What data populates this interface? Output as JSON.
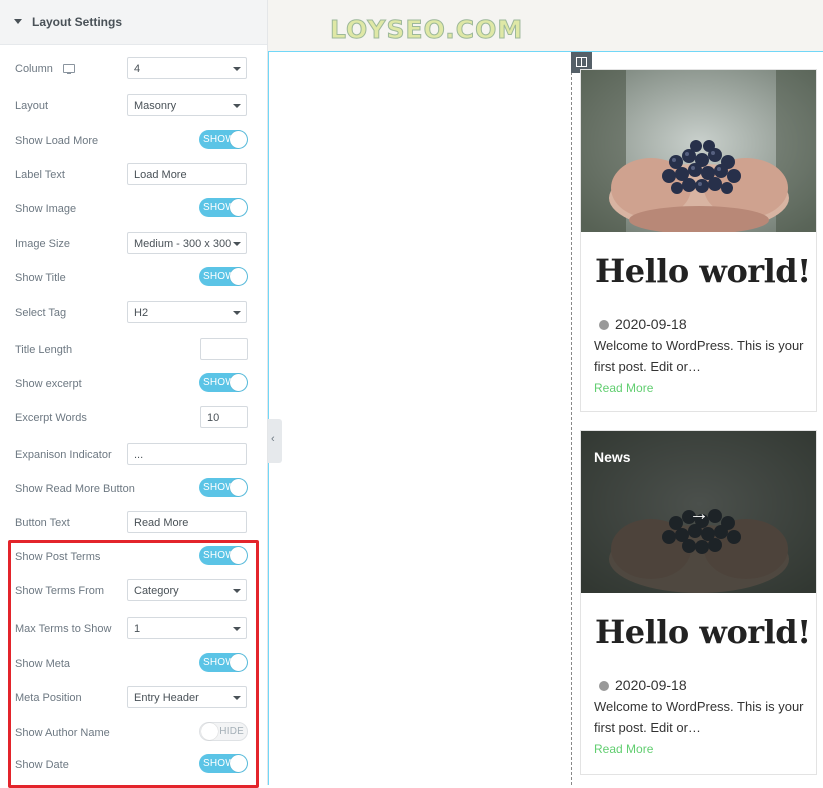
{
  "panel": {
    "section_title": "Layout Settings",
    "controls": [
      {
        "label": "Column",
        "type": "select",
        "value": "4",
        "icon": "monitor-icon"
      },
      {
        "label": "Layout",
        "type": "select",
        "value": "Masonry"
      },
      {
        "label": "Show Load More",
        "type": "toggle",
        "value": "SHOW"
      },
      {
        "label": "Label Text",
        "type": "text",
        "value": "Load More"
      },
      {
        "label": "Show Image",
        "type": "toggle",
        "value": "SHOW"
      },
      {
        "label": "Image Size",
        "type": "select",
        "value": "Medium - 300 x 300"
      },
      {
        "label": "Show Title",
        "type": "toggle",
        "value": "SHOW"
      },
      {
        "label": "Select Tag",
        "type": "select",
        "value": "H2"
      },
      {
        "label": "Title Length",
        "type": "number",
        "value": ""
      },
      {
        "label": "Show excerpt",
        "type": "toggle",
        "value": "SHOW"
      },
      {
        "label": "Excerpt Words",
        "type": "number",
        "value": "10"
      },
      {
        "label": "Expanison Indicator",
        "type": "text",
        "value": "..."
      },
      {
        "label": "Show Read More Button",
        "type": "toggle",
        "value": "SHOW"
      },
      {
        "label": "Button Text",
        "type": "text",
        "value": "Read More"
      },
      {
        "label": "Show Post Terms",
        "type": "toggle",
        "value": "SHOW"
      },
      {
        "label": "Show Terms From",
        "type": "select",
        "value": "Category"
      },
      {
        "label": "Max Terms to Show",
        "type": "select",
        "value": "1"
      },
      {
        "label": "Show Meta",
        "type": "toggle",
        "value": "SHOW"
      },
      {
        "label": "Meta Position",
        "type": "select",
        "value": "Entry Header"
      },
      {
        "label": "Show Author Name",
        "type": "toggle",
        "value": "HIDE",
        "off": true
      },
      {
        "label": "Show Date",
        "type": "toggle",
        "value": "SHOW"
      }
    ]
  },
  "preview": {
    "brand": "LOYSEO.COM",
    "collapse_glyph": "‹",
    "posts": [
      {
        "title": "Hello world!",
        "date": "2020-09-18",
        "excerpt": "Welcome to WordPress. This is your first post. Edit or…",
        "read_more": "Read More",
        "term": "",
        "overlay": false
      },
      {
        "title": "Hello world!",
        "date": "2020-09-18",
        "excerpt": "Welcome to WordPress. This is your first post. Edit or…",
        "read_more": "Read More",
        "term": "News",
        "overlay": true,
        "overlay_glyph": "→"
      }
    ]
  },
  "colors": {
    "toggle_on": "#5bc4e6",
    "highlight": "#e3242b",
    "read_more": "#61ce70",
    "canvas_line": "#71d7f7"
  }
}
